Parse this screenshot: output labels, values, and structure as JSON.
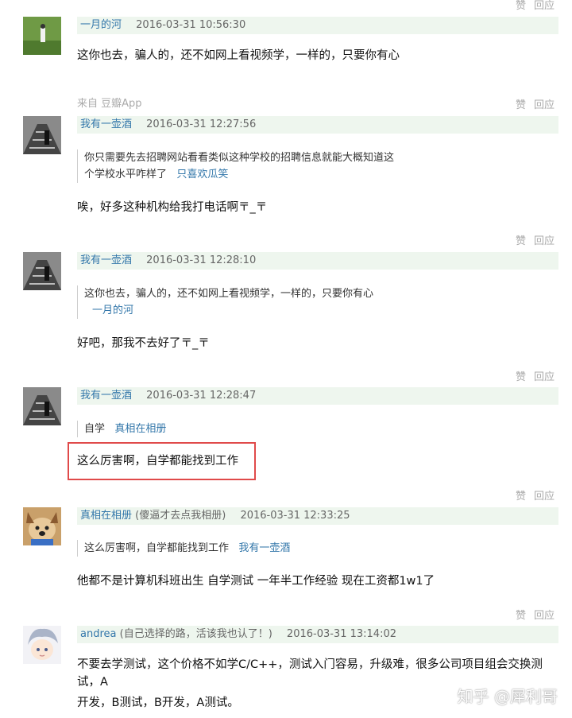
{
  "actions": {
    "like": "赞",
    "reply": "回应"
  },
  "comments": [
    {
      "author": "一月的河",
      "signature": "",
      "time": "2016-03-31 10:56:30",
      "quote": null,
      "content": "这你也去，骗人的，还不如网上看视频学，一样的，只要你有心",
      "source": "来自 豆瓣App"
    },
    {
      "author": "我有一壶酒",
      "signature": "",
      "time": "2016-03-31 12:27:56",
      "quote": {
        "line1": "你只需要先去招聘网站看看类似这种学校的招聘信息就能大概知道这",
        "line2": "个学校水平咋样了",
        "author": "只喜欢瓜笑"
      },
      "content": "唉，好多这种机构给我打电话啊〒_〒"
    },
    {
      "author": "我有一壶酒",
      "signature": "",
      "time": "2016-03-31 12:28:10",
      "quote": {
        "line1": "这你也去，骗人的，还不如网上看视频学，一样的，只要你有心",
        "author": "一月的河"
      },
      "content": "好吧，那我不去好了〒_〒"
    },
    {
      "author": "我有一壶酒",
      "signature": "",
      "time": "2016-03-31 12:28:47",
      "quote": {
        "line1": "自学",
        "author": "真相在相册"
      },
      "content": "这么厉害啊，自学都能找到工作"
    },
    {
      "author": "真相在相册",
      "signature": "(傻逼才去点我相册)",
      "time": "2016-03-31 12:33:25",
      "quote": {
        "line1": "这么厉害啊，自学都能找到工作",
        "author": "我有一壶酒"
      },
      "content": "他都不是计算机科班出生 自学测试 一年半工作经验 现在工资都1w1了"
    },
    {
      "author": "andrea",
      "signature": "(自己选择的路，活该我也认了！)",
      "time": "2016-03-31 13:14:02",
      "quote": null,
      "content": "不要去学测试，这个价格不如学C/C++，测试入门容易，升级难，很多公司项目组会交换测试，A",
      "content2": "开发，B测试，B开发，A测试。"
    }
  ],
  "watermark": "知乎 @犀利哥",
  "colors": {
    "link": "#3377aa",
    "header_bg": "#eef6ee",
    "highlight": "#e04a4a",
    "meta": "#aaaaaa"
  }
}
